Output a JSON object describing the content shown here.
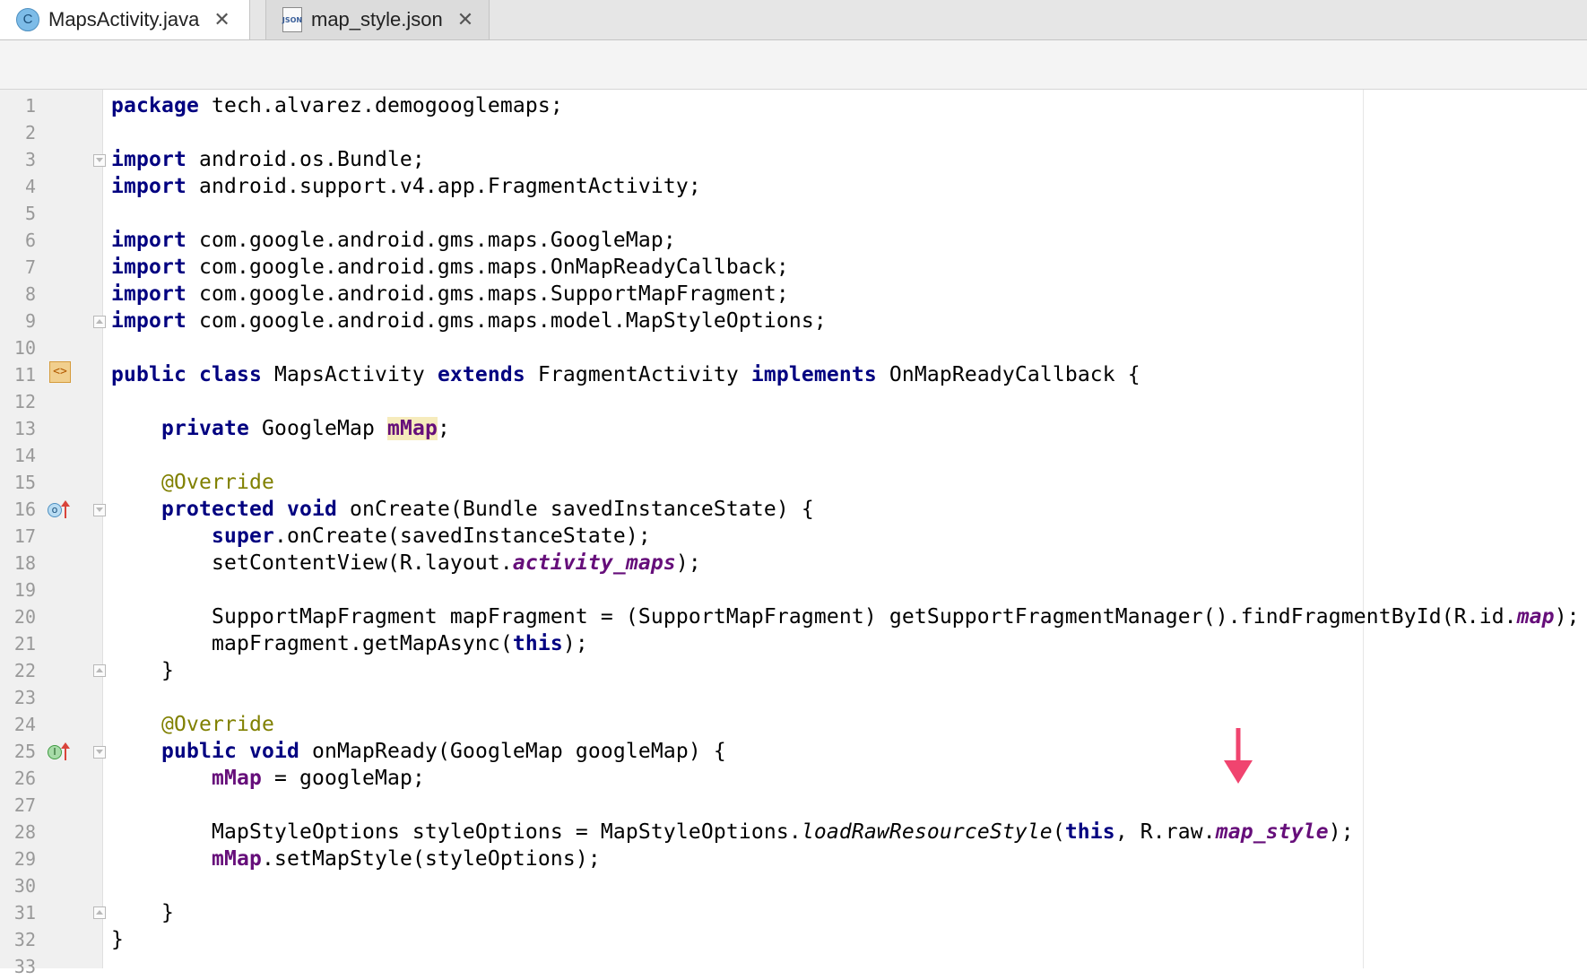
{
  "tabs": [
    {
      "label": "MapsActivity.java",
      "icon": "class-icon",
      "icon_text": "C",
      "close": "✕",
      "active": true
    },
    {
      "label": "map_style.json",
      "icon": "json-file-icon",
      "icon_text": "JSON",
      "close": "✕",
      "active": false
    }
  ],
  "gutter": {
    "class_icon_text": "<>",
    "override_icon_text": "o",
    "implements_icon_text": "I"
  },
  "colors": {
    "keyword": "#000080",
    "annotation": "#808000",
    "field": "#660e7a",
    "line_number": "#999999",
    "highlight": "#f6ebbc",
    "arrow": "#f0446f"
  },
  "code": [
    {
      "n": "1",
      "tokens": [
        {
          "c": "kw",
          "t": "package"
        },
        {
          "t": " tech.alvarez.demogooglemaps;"
        }
      ]
    },
    {
      "n": "2",
      "tokens": []
    },
    {
      "n": "3",
      "tokens": [
        {
          "c": "kw",
          "t": "import"
        },
        {
          "t": " android.os.Bundle;"
        }
      ]
    },
    {
      "n": "4",
      "tokens": [
        {
          "c": "kw",
          "t": "import"
        },
        {
          "t": " android.support.v4.app.FragmentActivity;"
        }
      ]
    },
    {
      "n": "5",
      "tokens": []
    },
    {
      "n": "6",
      "tokens": [
        {
          "c": "kw",
          "t": "import"
        },
        {
          "t": " com.google.android.gms.maps.GoogleMap;"
        }
      ]
    },
    {
      "n": "7",
      "tokens": [
        {
          "c": "kw",
          "t": "import"
        },
        {
          "t": " com.google.android.gms.maps.OnMapReadyCallback;"
        }
      ]
    },
    {
      "n": "8",
      "tokens": [
        {
          "c": "kw",
          "t": "import"
        },
        {
          "t": " com.google.android.gms.maps.SupportMapFragment;"
        }
      ]
    },
    {
      "n": "9",
      "tokens": [
        {
          "c": "kw",
          "t": "import"
        },
        {
          "t": " com.google.android.gms.maps.model.MapStyleOptions;"
        }
      ]
    },
    {
      "n": "10",
      "tokens": []
    },
    {
      "n": "11",
      "tokens": [
        {
          "c": "kw",
          "t": "public class"
        },
        {
          "t": " MapsActivity "
        },
        {
          "c": "kw",
          "t": "extends"
        },
        {
          "t": " FragmentActivity "
        },
        {
          "c": "kw",
          "t": "implements"
        },
        {
          "t": " OnMapReadyCallback {"
        }
      ]
    },
    {
      "n": "12",
      "tokens": []
    },
    {
      "n": "13",
      "tokens": [
        {
          "t": "    "
        },
        {
          "c": "kw",
          "t": "private"
        },
        {
          "t": " GoogleMap "
        },
        {
          "c": "field hl",
          "t": "mMap"
        },
        {
          "t": ";"
        }
      ]
    },
    {
      "n": "14",
      "tokens": []
    },
    {
      "n": "15",
      "tokens": [
        {
          "t": "    "
        },
        {
          "c": "ann",
          "t": "@Override"
        }
      ]
    },
    {
      "n": "16",
      "tokens": [
        {
          "t": "    "
        },
        {
          "c": "kw",
          "t": "protected void"
        },
        {
          "t": " onCreate(Bundle savedInstanceState) {"
        }
      ]
    },
    {
      "n": "17",
      "tokens": [
        {
          "t": "        "
        },
        {
          "c": "kw",
          "t": "super"
        },
        {
          "t": ".onCreate(savedInstanceState);"
        }
      ]
    },
    {
      "n": "18",
      "tokens": [
        {
          "t": "        setContentView(R.layout."
        },
        {
          "c": "field-i",
          "t": "activity_maps"
        },
        {
          "t": ");"
        }
      ]
    },
    {
      "n": "19",
      "tokens": []
    },
    {
      "n": "20",
      "tokens": [
        {
          "t": "        SupportMapFragment mapFragment = (SupportMapFragment) getSupportFragmentManager().findFragmentById(R.id."
        },
        {
          "c": "field-i",
          "t": "map"
        },
        {
          "t": ");"
        }
      ]
    },
    {
      "n": "21",
      "tokens": [
        {
          "t": "        mapFragment.getMapAsync("
        },
        {
          "c": "kw",
          "t": "this"
        },
        {
          "t": ");"
        }
      ]
    },
    {
      "n": "22",
      "tokens": [
        {
          "t": "    }"
        }
      ]
    },
    {
      "n": "23",
      "tokens": []
    },
    {
      "n": "24",
      "tokens": [
        {
          "t": "    "
        },
        {
          "c": "ann",
          "t": "@Override"
        }
      ]
    },
    {
      "n": "25",
      "tokens": [
        {
          "t": "    "
        },
        {
          "c": "kw",
          "t": "public void"
        },
        {
          "t": " onMapReady(GoogleMap googleMap) {"
        }
      ]
    },
    {
      "n": "26",
      "tokens": [
        {
          "t": "        "
        },
        {
          "c": "field",
          "t": "mMap"
        },
        {
          "t": " = googleMap;"
        }
      ]
    },
    {
      "n": "27",
      "tokens": []
    },
    {
      "n": "28",
      "tokens": [
        {
          "t": "        MapStyleOptions styleOptions = MapStyleOptions."
        },
        {
          "c": "static-m",
          "t": "loadRawResourceStyle"
        },
        {
          "t": "("
        },
        {
          "c": "kw",
          "t": "this"
        },
        {
          "t": ", R.raw."
        },
        {
          "c": "field-i",
          "t": "map_style"
        },
        {
          "t": ");"
        }
      ]
    },
    {
      "n": "29",
      "tokens": [
        {
          "t": "        "
        },
        {
          "c": "field",
          "t": "mMap"
        },
        {
          "t": ".setMapStyle(styleOptions);"
        }
      ]
    },
    {
      "n": "30",
      "tokens": []
    },
    {
      "n": "31",
      "tokens": [
        {
          "t": "    }"
        }
      ]
    },
    {
      "n": "32",
      "tokens": [
        {
          "t": "}"
        }
      ]
    },
    {
      "n": "33",
      "tokens": []
    }
  ]
}
